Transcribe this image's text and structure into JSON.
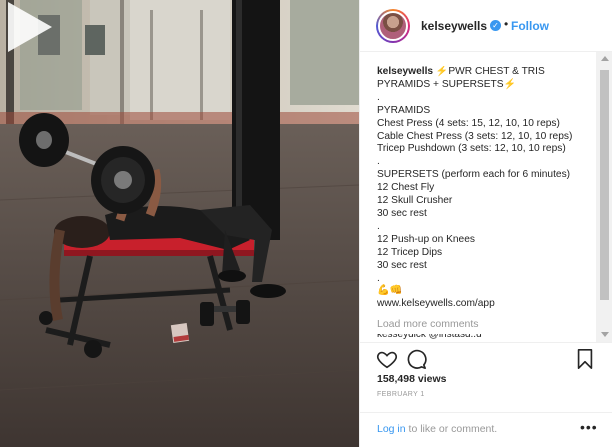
{
  "post": {
    "username": "kelseywells",
    "follow_label": "Follow",
    "separator": "•",
    "verified_mark": "✓"
  },
  "caption": {
    "lines": [
      {
        "user": "kelseywells",
        "text": "PWR CHEST & TRIS"
      },
      {
        "text": "PYRAMIDS + SUPERSETS"
      },
      {
        "text": "."
      },
      {
        "text": "PYRAMIDS"
      },
      {
        "text": "Chest Press (4 sets: 15, 12, 10, 10 reps)"
      },
      {
        "text": "Cable Chest Press (3 sets: 12, 10, 10 reps)"
      },
      {
        "text": "Tricep Pushdown (3 sets: 12, 10, 10 reps)"
      },
      {
        "text": "."
      },
      {
        "text": "SUPERSETS (perform each for 6 minutes)"
      },
      {
        "text": "12 Chest Fly"
      },
      {
        "text": "12 Skull Crusher"
      },
      {
        "text": "30 sec rest"
      },
      {
        "text": "."
      },
      {
        "text": "12 Push-up on Knees"
      },
      {
        "text": "12 Tricep Dips"
      },
      {
        "text": "30 sec rest"
      },
      {
        "text": "."
      },
      {
        "text": "💪👊"
      },
      {
        "text": "www.kelseywells.com/app"
      }
    ],
    "load_more": "Load more comments"
  },
  "stats": {
    "views": "158,498 views",
    "date": "FEBRUARY 1"
  },
  "login": {
    "link": "Log in",
    "rest": " to like or comment.",
    "more": "•••"
  },
  "icons": {
    "like": "heart-icon",
    "comment": "comment-icon",
    "save": "bookmark-icon",
    "play": "play-icon",
    "bolt": "lightning-icon"
  },
  "colors": {
    "accent": "#3897f0",
    "muted": "#999999",
    "text": "#262626"
  }
}
